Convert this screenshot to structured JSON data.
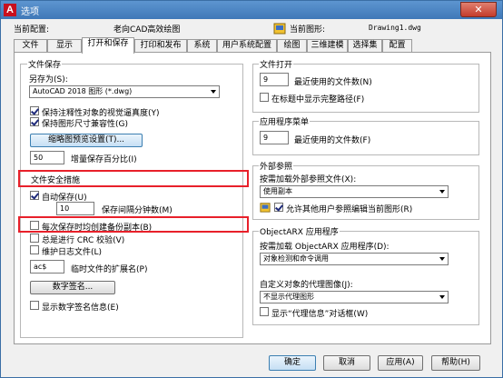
{
  "window": {
    "title": "选项",
    "close_label": "✕"
  },
  "profile": {
    "current_config_label": "当前配置:",
    "current_config_value": "老向CAD高效绘图",
    "current_drawing_label": "当前图形:",
    "current_drawing_value": "Drawing1.dwg"
  },
  "tabs": [
    {
      "label": "文件"
    },
    {
      "label": "显示"
    },
    {
      "label": "打开和保存"
    },
    {
      "label": "打印和发布"
    },
    {
      "label": "系统"
    },
    {
      "label": "用户系统配置"
    },
    {
      "label": "绘图"
    },
    {
      "label": "三维建模"
    },
    {
      "label": "选择集"
    },
    {
      "label": "配置"
    }
  ],
  "file_save": {
    "title": "文件保存",
    "save_as_label": "另存为(S):",
    "save_as_value": "AutoCAD 2018 图形 (*.dwg)",
    "annot_fidelity": "保持注释性对象的视觉逼真度(Y)",
    "size_compat": "保持图形尺寸兼容性(G)",
    "thumb_button": "缩略图预览设置(T)...",
    "incr_value": "50",
    "incr_label": "增量保存百分比(I)"
  },
  "safety": {
    "title": "文件安全措施",
    "autosave": "自动保存(U)",
    "interval_value": "10",
    "interval_label": "保存间隔分钟数(M)",
    "backup": "每次保存时均创建备份副本(B)",
    "crc": "总是进行 CRC 校验(V)",
    "log": "维护日志文件(L)",
    "ext_value": "ac$",
    "ext_label": "临时文件的扩展名(P)",
    "signature_button": "数字签名...",
    "show_signature": "显示数字签名信息(E)"
  },
  "file_open": {
    "title": "文件打开",
    "recent_value": "9",
    "recent_label": "最近使用的文件数(N)",
    "full_path": "在标题中显示完整路径(F)"
  },
  "app_menu": {
    "title": "应用程序菜单",
    "recent_value": "9",
    "recent_label": "最近使用的文件数(F)"
  },
  "xref": {
    "title": "外部参照",
    "demand_label": "按需加载外部参照文件(X):",
    "demand_value": "使用副本",
    "allow_edit": "允许其他用户参照编辑当前图形(R)"
  },
  "objectarx": {
    "title": "ObjectARX 应用程序",
    "demand_label": "按需加载 ObjectARX 应用程序(D):",
    "demand_value": "对象检测和命令调用",
    "proxy_label": "自定义对象的代理图像(J):",
    "proxy_value": "不显示代理图形",
    "proxy_dialog": "显示“代理信息”对话框(W)"
  },
  "buttons": {
    "ok": "确定",
    "cancel": "取消",
    "apply": "应用(A)",
    "help": "帮助(H)"
  },
  "colors": {
    "highlight": "#e8202a",
    "title_bar": "#3f78b8"
  }
}
